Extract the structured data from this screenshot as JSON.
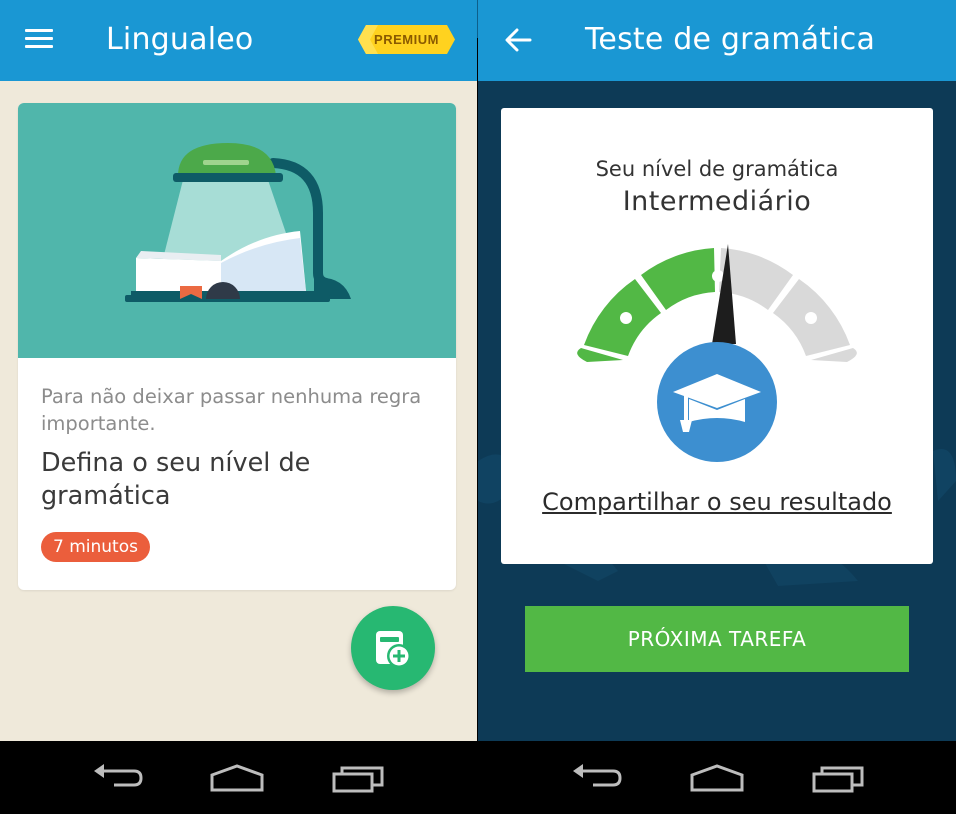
{
  "left_screen": {
    "appbar": {
      "menu_icon": "menu-icon",
      "title": "Lingualeo",
      "premium_label": "PREMIUM"
    },
    "card": {
      "illustration": "lamp-and-book-illustration",
      "subtitle": "Para não deixar passar nenhuma regra importante.",
      "title": "Defina o seu nível de gramática",
      "duration_badge": "7 minutos"
    },
    "fab_icon": "add-card-icon"
  },
  "right_screen": {
    "appbar": {
      "back_icon": "arrow-left-icon",
      "title": "Teste de gramática"
    },
    "result": {
      "label": "Seu nível de gramática",
      "level": "Intermediário",
      "gauge_levels": 4,
      "gauge_filled": 2,
      "gauge_icon": "graduation-cap-icon",
      "share_link": "Compartilhar o seu resultado"
    },
    "next_button": "PRÓXIMA TAREFA"
  },
  "navbar": {
    "buttons": [
      "back-nav-icon",
      "home-nav-icon",
      "recents-nav-icon"
    ]
  },
  "colors": {
    "appbar": "#1a97d3",
    "left_bg": "#efe9da",
    "right_bg": "#0d3a56",
    "card_illus_bg": "#50b6ab",
    "badge": "#eb5e3c",
    "fab": "#27b872",
    "gauge_green": "#52b845",
    "gauge_gray": "#d9d9d9",
    "gauge_center": "#3d8fd0",
    "next_button": "#52b845"
  }
}
